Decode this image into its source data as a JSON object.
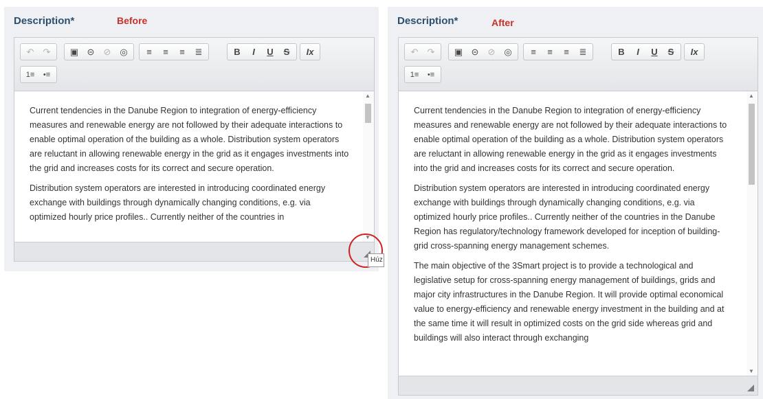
{
  "before": {
    "label": "Description*",
    "tag": "Before",
    "paragraphs": [
      "Current tendencies in the Danube Region to integration of energy-efficiency measures and renewable energy are not followed by their adequate interactions to enable optimal operation of the building as a whole. Distribution system operators are reluctant in allowing renewable energy in the grid as it engages investments into the grid and increases costs for its correct and secure operation.",
      "Distribution system operators are interested in introducing coordinated energy exchange with buildings through dynamically changing conditions, e.g. via optimized hourly price profiles.. Currently neither of the countries in"
    ],
    "tooltip": "Húz"
  },
  "after": {
    "label": "Description*",
    "tag": "After",
    "paragraphs": [
      "Current tendencies in the Danube Region to integration of energy-efficiency measures and renewable energy are not followed by their adequate interactions to enable optimal operation of the building as a whole. Distribution system operators are reluctant in allowing renewable energy in the grid as it engages investments into the grid and increases costs for its correct and secure operation.",
      "Distribution system operators are interested in introducing coordinated energy exchange with buildings through dynamically changing conditions, e.g. via optimized hourly price profiles.. Currently neither of the countries in the Danube Region has regulatory/technology framework developed for inception of building-grid cross-spanning energy management schemes.",
      " The main objective of the 3Smart project is to provide a technological and legislative setup for cross-spanning energy management of buildings, grids and major city infrastructures in the Danube Region. It will provide optimal economical value to energy-efficiency and renewable energy investment in the building and at the same time it will result in optimized costs on the grid side whereas grid and buildings will also interact through exchanging"
    ]
  },
  "toolbar": {
    "undo": "↶",
    "redo": "↷",
    "image": "▣",
    "link": "⊝",
    "unlink": "⊘",
    "anchor": "◎",
    "align_left": "≡",
    "align_center": "≡",
    "align_right": "≡",
    "align_justify": "≣",
    "bold": "B",
    "italic": "I",
    "underline": "U",
    "strike": "S",
    "clear_format": "Ix",
    "numbered_list": "1≡",
    "bulleted_list": "•≡"
  },
  "icons": {
    "undo": "undo-icon",
    "redo": "redo-icon",
    "image": "image-icon",
    "link": "link-icon",
    "unlink": "unlink-icon",
    "anchor": "globe-icon",
    "resize": "resize-grip-icon"
  },
  "colors": {
    "label": "#2c4f6e",
    "tag": "#c8302a",
    "highlight_circle": "#d21f1f"
  }
}
